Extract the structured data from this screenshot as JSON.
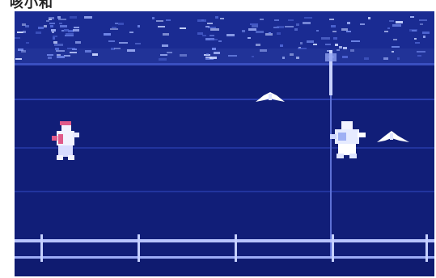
{
  "caption": "咳小和",
  "colors": {
    "frame": "#ffffff",
    "field": "#111e78",
    "field_dark": "#0d1866",
    "grandstand": "#2436a6",
    "crowd_light": "#c8d4ff",
    "crowd_mid": "#6f86e8",
    "net_line": "#3e52c4",
    "net_white": "#e6ebff",
    "player_body": "#f2f2ff",
    "player_accent": "#e05a8a",
    "shuttle": "#ffffff"
  },
  "scene": {
    "players": [
      {
        "id": "left-player",
        "side": "left"
      },
      {
        "id": "right-player",
        "side": "right"
      }
    ],
    "shuttles": [
      {
        "id": "shuttle-center"
      },
      {
        "id": "shuttle-right"
      }
    ]
  }
}
